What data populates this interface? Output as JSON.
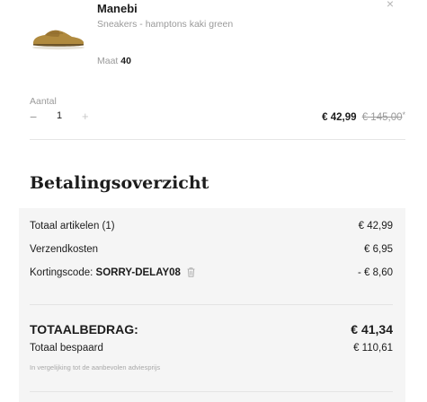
{
  "product": {
    "brand": "Manebi",
    "description": "Sneakers - hamptons kaki green",
    "size_label": "Maat",
    "size_value": "40",
    "close_icon": "close-icon",
    "image_icon": "sneaker-image"
  },
  "quantity": {
    "label": "Aantal",
    "value": "1",
    "minus": "−",
    "plus": "+"
  },
  "price": {
    "current": "€ 42,99",
    "original": "€ 145,00",
    "original_marker": "*"
  },
  "summary": {
    "title": "Betalingsoverzicht",
    "items_label": "Totaal artikelen (1)",
    "items_value": "€ 42,99",
    "shipping_label": "Verzendkosten",
    "shipping_value": "€ 6,95",
    "discount_label": "Kortingscode:",
    "discount_code": "SORRY-DELAY08",
    "discount_value": "- € 8,60",
    "total_label": "TOTAALBEDRAG:",
    "total_value": "€ 41,34",
    "saved_label": "Totaal bespaard",
    "saved_value": "€ 110,61",
    "saved_note": "In vergelijking tot de aanbevolen adviesprijs"
  },
  "colors": {
    "panel_bg": "#f5f5f5",
    "text": "#1c1c1c",
    "muted": "#9a9a9a",
    "shoe": "#b08a3e"
  }
}
